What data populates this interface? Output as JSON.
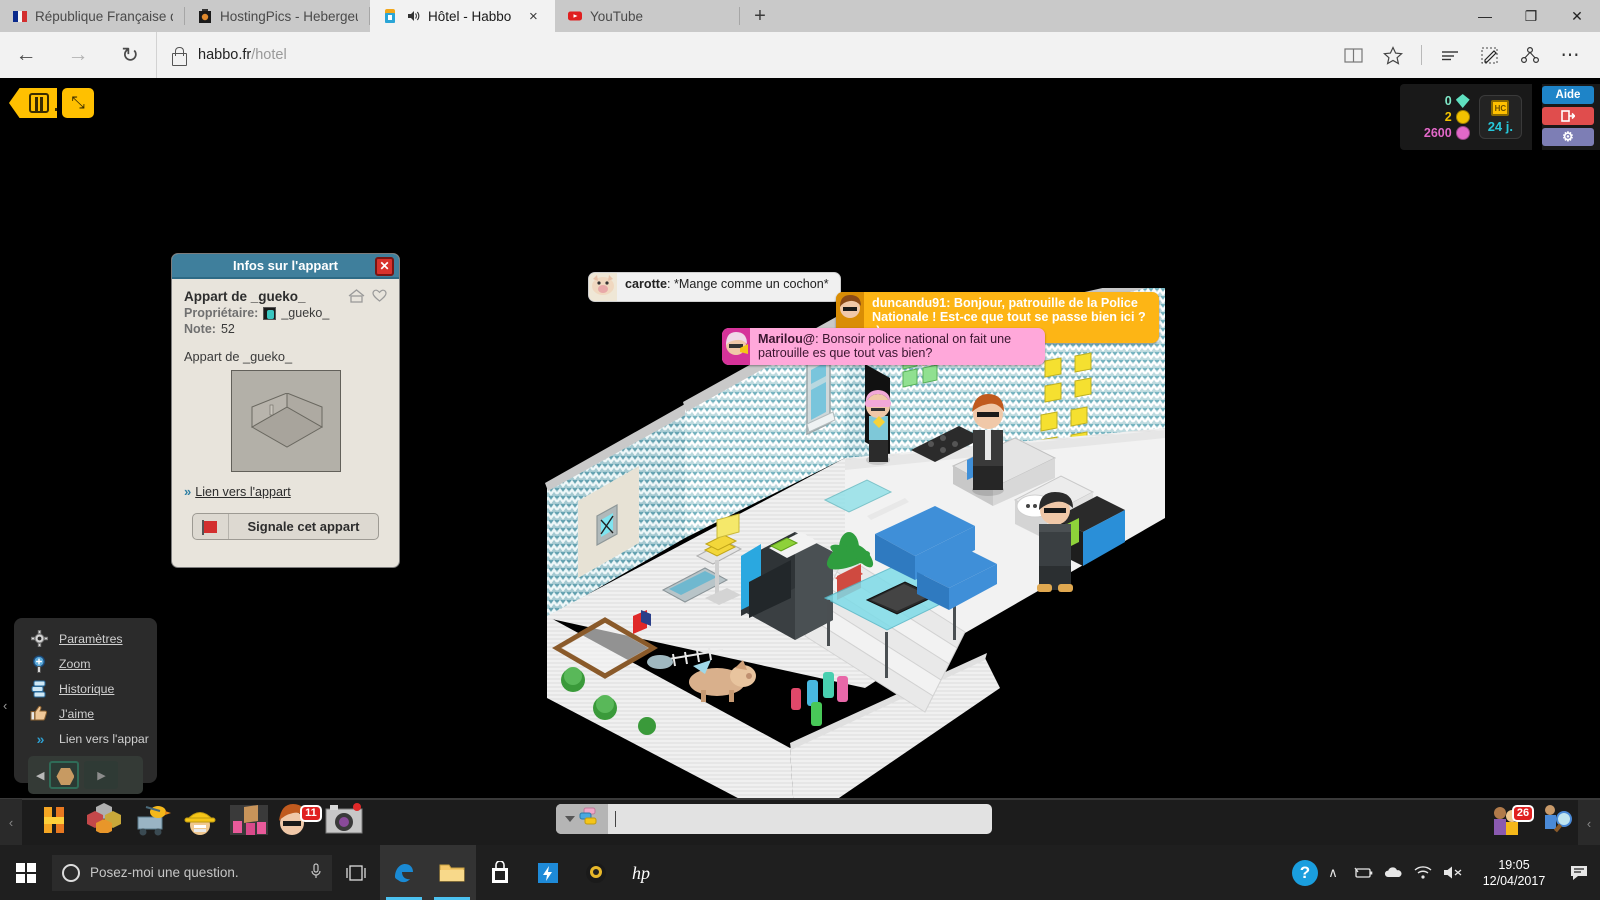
{
  "browser": {
    "tabs": [
      {
        "title": "République Française de Ha",
        "favicon": "french-flag-icon",
        "active": false
      },
      {
        "title": "HostingPics - Hebergeur d'i",
        "favicon": "camera-icon",
        "active": false
      },
      {
        "title": "Hôtel - Habbo",
        "favicon": "habbo-icon",
        "active": true,
        "audio": "speaker-icon",
        "close": "×"
      },
      {
        "title": "YouTube",
        "favicon": "youtube-icon",
        "active": false
      }
    ],
    "new_tab_label": "+",
    "window_controls": {
      "minimize": "—",
      "maximize": "❐",
      "close": "✕"
    },
    "nav": {
      "back": "←",
      "forward": "→",
      "refresh": "↻"
    },
    "url": {
      "domain": "habbo.fr",
      "path": "/hotel",
      "lock": "lock-icon"
    },
    "tools": [
      {
        "name": "reading-view-icon",
        "glyph": "▭"
      },
      {
        "name": "favorites-star-icon",
        "glyph": "☆"
      },
      {
        "name": "hub-icon",
        "glyph": "☰"
      },
      {
        "name": "web-note-icon",
        "glyph": "✎"
      },
      {
        "name": "share-icon",
        "glyph": "⚭"
      },
      {
        "name": "more-settings-icon",
        "glyph": "⋯"
      }
    ]
  },
  "client": {
    "top_left": {
      "back_button": "habbo-home-button",
      "expand_button": "fullscreen-button",
      "expand_glyph": "⤡"
    },
    "hud": {
      "currencies": [
        {
          "amount": "0",
          "type": "diamonds",
          "color": "#7fe8c8"
        },
        {
          "amount": "2",
          "type": "credits",
          "color": "#f2c200"
        },
        {
          "amount": "2600",
          "type": "duckets",
          "color": "#e268c8"
        }
      ],
      "hc": {
        "badge": "HC",
        "days": "24 j."
      },
      "buttons": [
        {
          "label": "Aide",
          "name": "help-button",
          "color": "#1e84c8"
        },
        {
          "label": "",
          "name": "logout-button",
          "color": "#e04d4d",
          "glyph": "⇥"
        },
        {
          "label": "",
          "name": "settings-button",
          "color": "#7d7eb5",
          "glyph": "⚙"
        }
      ]
    },
    "chat": [
      {
        "user": "carotte",
        "message": "*Mange comme un cochon*",
        "avatar": "pig-avatar-icon",
        "style": "white"
      },
      {
        "user": "duncandu91",
        "message": "Bonjour, patrouille de la Police Nationale ! Est-ce que tout se passe bien ici ? :)",
        "avatar": "duncandu-avatar-icon",
        "style": "orange"
      },
      {
        "user": "Marilou@",
        "message": "Bonsoir police national on fait une patrouille es que tout vas bien?",
        "avatar": "marilou-avatar-icon",
        "style": "pink"
      }
    ],
    "info_panel": {
      "header": "Infos sur l'appart",
      "close": "✕",
      "room_title": "Appart de _gueko_",
      "owner_label": "Propriétaire:",
      "owner_name": "_gueko_",
      "rating_label": "Note:",
      "rating_value": "52",
      "description": "Appart de _gueko_",
      "link_label": "Lien vers l'appart",
      "link_chevron": "»",
      "report_label": "Signale cet appart",
      "icons": {
        "home": "home-icon",
        "favorite": "heart-icon"
      }
    },
    "context_menu": {
      "items": [
        {
          "label": "Paramètres",
          "icon": "gear-icon",
          "glyph": "⚙"
        },
        {
          "label": "Zoom",
          "icon": "magnifier-plus-icon",
          "glyph": "⊕"
        },
        {
          "label": "Historique",
          "icon": "chat-history-icon",
          "glyph": "≣"
        },
        {
          "label": "J'aime",
          "icon": "thumbs-up-icon",
          "glyph": "☝"
        },
        {
          "label": "Lien vers l'appar",
          "icon": "double-chevron-icon",
          "glyph": "»"
        }
      ],
      "collapse_glyph": "‹",
      "nav_prev": "◀",
      "nav_next": "▶"
    },
    "toolbar": {
      "left_collapse": "‹",
      "right_collapse": "‹",
      "icons": [
        {
          "name": "habbo-logo-button",
          "badge": ""
        },
        {
          "name": "inventory-button",
          "badge": ""
        },
        {
          "name": "catalogue-button",
          "badge": ""
        },
        {
          "name": "builders-club-button",
          "badge": ""
        },
        {
          "name": "room-furni-button",
          "badge": ""
        },
        {
          "name": "avatar-profile-button",
          "badge": "11"
        },
        {
          "name": "camera-button",
          "badge": ""
        }
      ],
      "right_icons": [
        {
          "name": "friends-button",
          "badge": "26"
        },
        {
          "name": "navigator-search-button",
          "badge": ""
        }
      ],
      "chat": {
        "value": "",
        "placeholder": "",
        "style_icon": "chat-style-icon",
        "caret": "▼"
      }
    },
    "room_scene": {
      "name": "habbo-isometric-room",
      "avatars": [
        {
          "name": "marilou-avatar",
          "hair": "#f0a8d8"
        },
        {
          "name": "duncandu-avatar",
          "hair": "#c05a1e"
        },
        {
          "name": "carotte-avatar",
          "hair": "#2b2b2b"
        }
      ]
    }
  },
  "taskbar": {
    "start": "windows-start-button",
    "search_placeholder": "Posez-moi une question.",
    "mic_icon": "microphone-icon",
    "task_view": "task-view-icon",
    "apps": [
      {
        "name": "edge-taskbar-button",
        "active": true
      },
      {
        "name": "file-explorer-taskbar-button",
        "active": true
      },
      {
        "name": "store-taskbar-button",
        "active": false
      },
      {
        "name": "shortcut-taskbar-button",
        "active": false
      },
      {
        "name": "media-taskbar-button",
        "active": false
      },
      {
        "name": "hp-taskbar-button",
        "active": false
      }
    ],
    "tray": [
      {
        "name": "help-tray-icon",
        "glyph": "?"
      },
      {
        "name": "show-hidden-icons",
        "glyph": "∧"
      },
      {
        "name": "battery-icon",
        "glyph": "▭"
      },
      {
        "name": "onedrive-icon",
        "glyph": "☁"
      },
      {
        "name": "wifi-icon",
        "glyph": "◡"
      },
      {
        "name": "volume-muted-icon",
        "glyph": "🔇"
      }
    ],
    "time": "19:05",
    "date": "12/04/2017",
    "action_center": "action-center-icon"
  }
}
